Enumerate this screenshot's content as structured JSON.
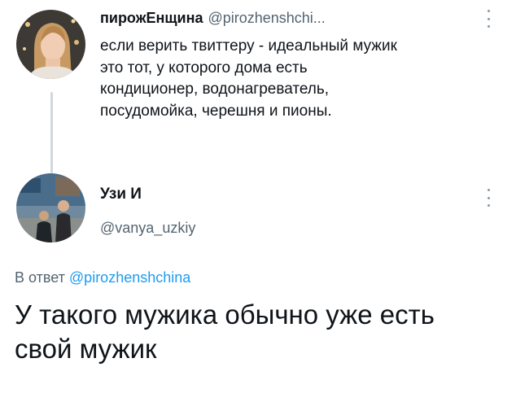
{
  "parent_tweet": {
    "author_name": "пирожЕнщина",
    "handle": "@pirozhenshchi...",
    "text_lines": [
      "если верить твиттеру - идеальный мужик",
      "это тот, у которого дома есть",
      "кондиционер, водонагреватель,",
      "посудомойка, черешня и пионы."
    ]
  },
  "reply_tweet": {
    "author_name": "Узи И",
    "handle": "@vanya_uzkiy",
    "reply_prefix": "В ответ",
    "reply_mention": "@pirozhenshchina",
    "text_lines": [
      "У такого мужика обычно уже есть",
      "свой мужик"
    ]
  },
  "icons": {
    "more_menu": "more-vertical-icon"
  },
  "colors": {
    "primary_text": "#0f1419",
    "secondary_text": "#536471",
    "mention": "#1d9bf0",
    "thread_line": "#cfd9de"
  }
}
